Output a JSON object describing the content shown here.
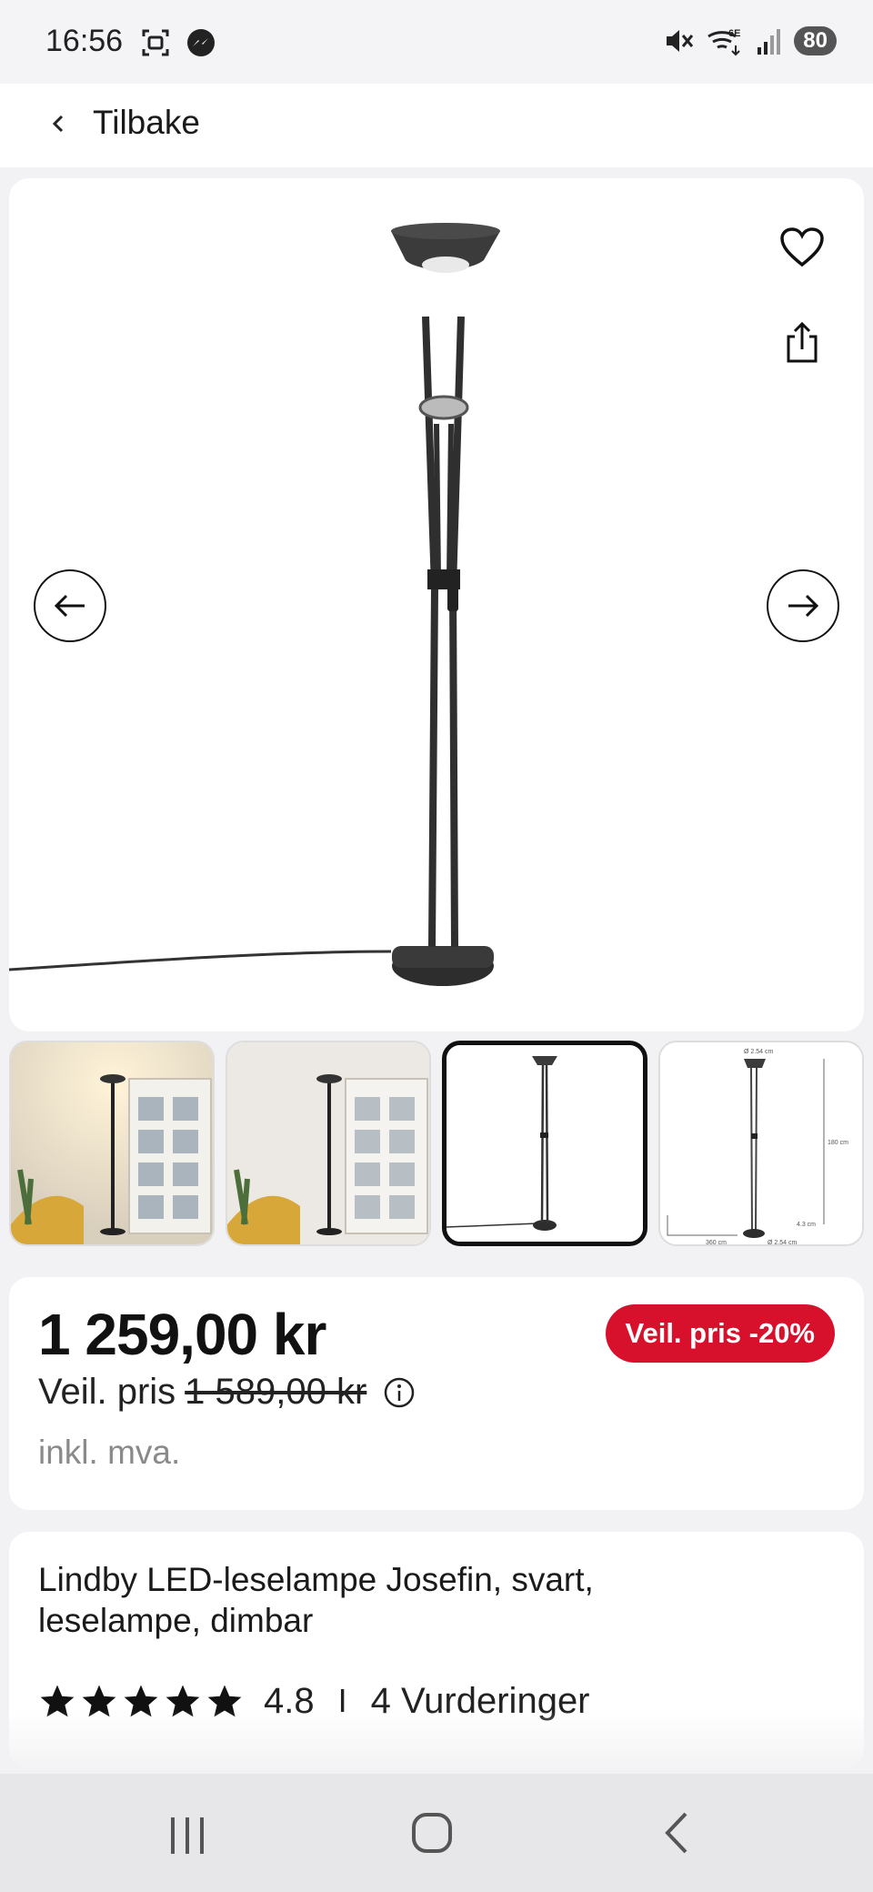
{
  "status_bar": {
    "time": "16:56",
    "battery": "80",
    "icons": [
      "screenshot-icon",
      "messenger-icon",
      "mute-icon",
      "wifi-6e-icon",
      "signal-icon",
      "battery-icon"
    ]
  },
  "header": {
    "back_label": "Tilbake"
  },
  "gallery": {
    "image_name": "lindby-josefin-floor-lamp",
    "thumbnails": [
      {
        "name": "lamp-in-room-lit"
      },
      {
        "name": "lamp-in-room-unlit"
      },
      {
        "name": "lamp-front-view",
        "active": true
      },
      {
        "name": "lamp-dimensions"
      }
    ],
    "dimension_labels": [
      "Ø 2.54 cm",
      "180 cm",
      "4.3 cm",
      "360 cm",
      "Ø 2.54 cm"
    ]
  },
  "price": {
    "current": "1 259,00 kr",
    "rrp_label": "Veil. pris",
    "rrp_value": "1 589,00 kr",
    "vat_note": "inkl. mva.",
    "discount_badge": "Veil. pris -20%"
  },
  "product": {
    "title": "Lindby LED-leselampe Josefin, svart, leselampe, dimbar",
    "rating": "4.8",
    "separator": "I",
    "reviews": "4 Vurderinger",
    "stars": 5
  },
  "colors": {
    "accent_red": "#d7102c",
    "text": "#1a1a1a",
    "muted": "#8a8a8a",
    "background": "#f2f2f4"
  }
}
